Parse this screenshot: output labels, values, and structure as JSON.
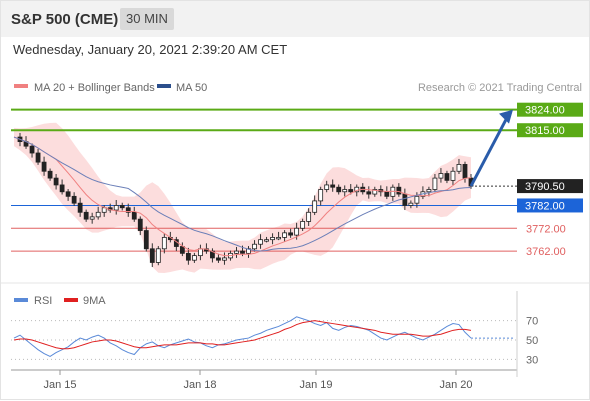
{
  "header": {
    "title": "S&P 500 (CME)",
    "timeframe": "30 MIN",
    "datetime": "Wednesday, January 20, 2021 2:39:20 AM CET"
  },
  "chart_data": {
    "type": "candlestick",
    "title": "S&P 500 (CME)",
    "price_panel": {
      "ylim": [
        3748,
        3830
      ],
      "legend": [
        {
          "label": "MA 20 + Bollinger Bands",
          "color": "#f08080"
        },
        {
          "label": "MA 50",
          "color": "#2b4f8c"
        }
      ],
      "source": "Research © 2021 Trading Central",
      "current_price": 3790.5,
      "levels": [
        {
          "value": 3824.0,
          "label": "3824.00",
          "kind": "resistance",
          "color": "#5aaa16"
        },
        {
          "value": 3815.0,
          "label": "3815.00",
          "kind": "resistance",
          "color": "#5aaa16"
        },
        {
          "value": 3782.0,
          "label": "3782.00",
          "kind": "pivot",
          "color": "#1c64d8"
        },
        {
          "value": 3772.0,
          "label": "3772.00",
          "kind": "support",
          "color": "#e06060"
        },
        {
          "value": 3762.0,
          "label": "3762.00",
          "kind": "support",
          "color": "#e06060"
        }
      ],
      "price_path": [
        3812,
        3810,
        3808,
        3805,
        3801,
        3797,
        3794,
        3791,
        3788,
        3786,
        3783,
        3779,
        3776,
        3777,
        3779,
        3781,
        3780,
        3782,
        3781,
        3779,
        3776,
        3771,
        3763,
        3757,
        3763,
        3768,
        3767,
        3764,
        3761,
        3758,
        3760,
        3763,
        3762,
        3759,
        3758,
        3759,
        3761,
        3762,
        3761,
        3763,
        3765,
        3767,
        3767,
        3768,
        3768,
        3770,
        3769,
        3772,
        3775,
        3779,
        3784,
        3789,
        3791,
        3790,
        3788,
        3789,
        3788,
        3790,
        3788,
        3787,
        3789,
        3788,
        3786,
        3790,
        3787,
        3782,
        3783,
        3786,
        3788,
        3789,
        3794,
        3796,
        3793,
        3797,
        3800,
        3794,
        3790.5
      ],
      "target_path": [
        3790.5,
        3824.0
      ]
    },
    "rsi_panel": {
      "legend": [
        {
          "label": "RSI",
          "color": "#5a8ad8"
        },
        {
          "label": "9MA",
          "color": "#e02020"
        }
      ],
      "ylim": [
        20,
        80
      ],
      "ticks": [
        70,
        50,
        30
      ],
      "rsi_path": [
        52,
        55,
        50,
        45,
        40,
        36,
        33,
        37,
        40,
        43,
        48,
        52,
        50,
        53,
        55,
        52,
        47,
        44,
        40,
        37,
        35,
        42,
        46,
        48,
        44,
        42,
        45,
        47,
        49,
        51,
        48,
        47,
        44,
        42,
        45,
        46,
        48,
        50,
        51,
        52,
        55,
        57,
        60,
        62,
        64,
        67,
        70,
        74,
        72,
        70,
        67,
        65,
        68,
        62,
        60,
        63,
        65,
        64,
        62,
        60,
        56,
        52,
        50,
        53,
        56,
        58,
        55,
        52,
        50,
        53,
        56,
        60,
        64,
        67,
        66,
        58,
        52
      ],
      "ma_path": [
        50,
        51,
        51,
        50,
        48,
        46,
        44,
        42,
        41,
        41,
        42,
        44,
        46,
        48,
        49,
        50,
        50,
        49,
        47,
        45,
        43,
        42,
        42,
        43,
        44,
        45,
        45,
        45,
        46,
        47,
        47,
        47,
        46,
        46,
        45,
        45,
        46,
        47,
        48,
        49,
        50,
        52,
        54,
        56,
        58,
        61,
        63,
        66,
        68,
        69,
        70,
        69,
        68,
        67,
        66,
        65,
        64,
        63,
        62,
        61,
        60,
        58,
        57,
        56,
        56,
        56,
        56,
        55,
        54,
        54,
        55,
        56,
        58,
        60,
        61,
        61,
        60
      ]
    },
    "x_axis": {
      "tick_labels": [
        "Jan 15",
        "Jan 18",
        "Jan 19",
        "Jan 20"
      ]
    }
  }
}
